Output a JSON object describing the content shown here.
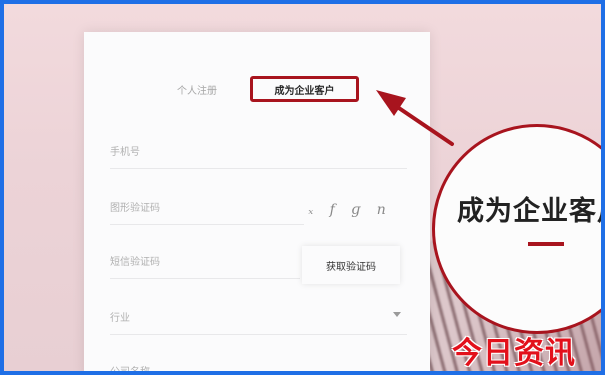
{
  "tabs": {
    "personal_label": "个人注册",
    "enterprise_label": "成为企业客户"
  },
  "form": {
    "phone_label": "手机号",
    "captcha_label": "图形验证码",
    "captcha_text": "ₓ f ɡ n",
    "sms_label": "短信验证码",
    "sms_button": "获取验证码",
    "select_label": "行业",
    "last_label": "公司名称"
  },
  "callout": {
    "text": "成为企业客户"
  },
  "watermark": "今日资讯",
  "colors": {
    "accent": "#a8141e",
    "border": "#1f6fe6",
    "watermark": "#e2101b"
  }
}
